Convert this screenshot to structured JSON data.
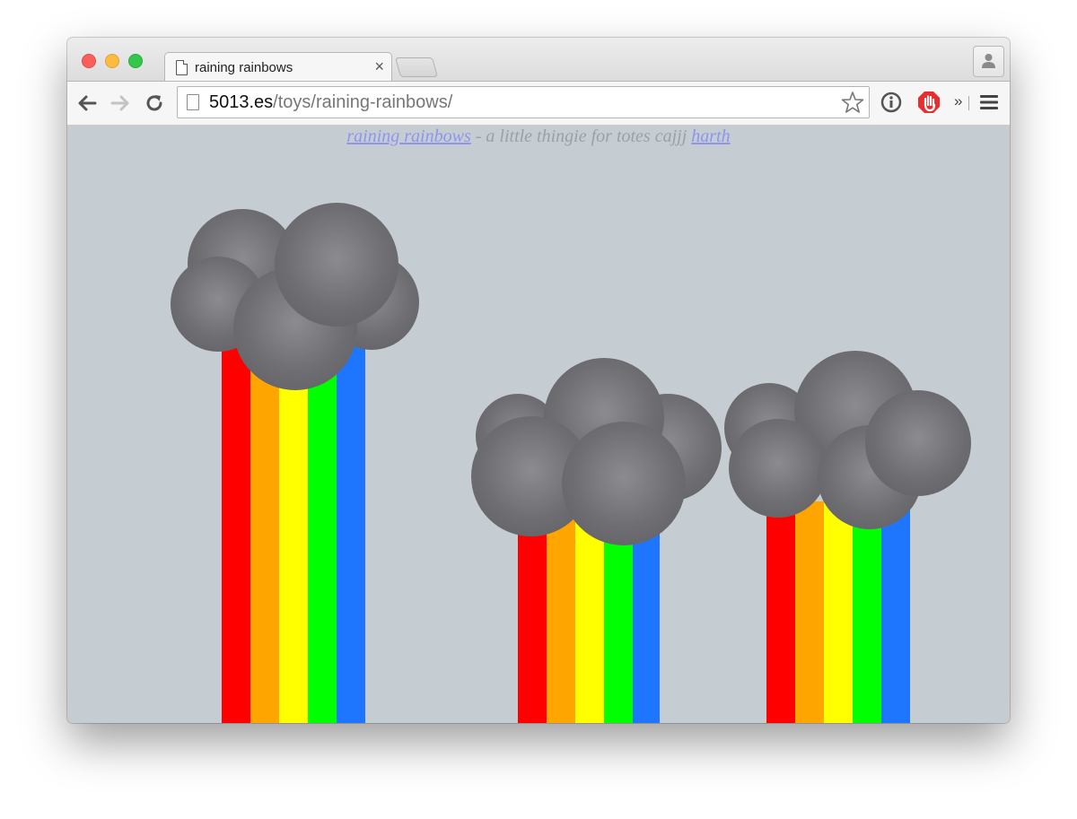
{
  "browser": {
    "tab_title": "raining rainbows",
    "tab_close": "×",
    "url_host": "5013.es",
    "url_path": "/toys/raining-rainbows/",
    "more_extensions": "»",
    "icons": [
      "back-arrow-icon",
      "forward-arrow-icon",
      "reload-icon",
      "page-icon",
      "star-icon",
      "info-extension-icon",
      "adblock-extension-icon",
      "menu-icon",
      "profile-icon"
    ]
  },
  "page": {
    "title_link": "raining rainbows",
    "caption_text": " - a little thingie for totes cajjj ",
    "author_link": "harth",
    "rainbow_colors": [
      "#ff0000",
      "#ffa500",
      "#ffff00",
      "#00ff00",
      "#1e76ff"
    ],
    "cloud_color": "#6e6e72",
    "background": "#c5cdd3"
  }
}
